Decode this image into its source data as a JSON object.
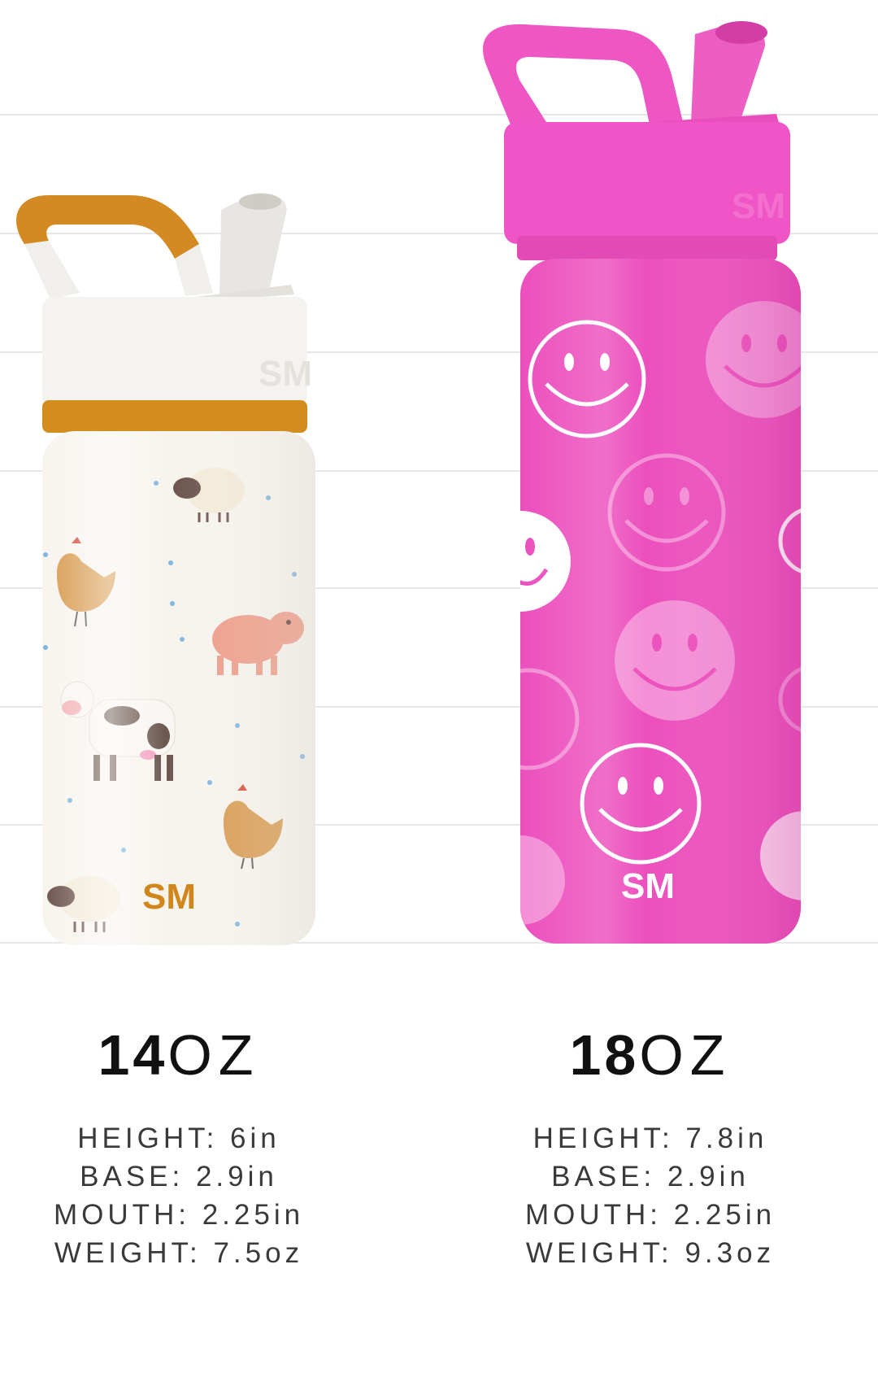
{
  "products": [
    {
      "size_number": "14",
      "size_unit": "OZ",
      "height": "HEIGHT: 6in",
      "base": "BASE: 2.9in",
      "mouth": "MOUTH: 2.25in",
      "weight": "WEIGHT: 7.5oz",
      "logo_text": "SM",
      "lid_logo_text": "SM",
      "colors": {
        "body": "#f7f4ee",
        "lid": "#f5f4f1",
        "accent": "#d58c1f",
        "logo": "#d1861c"
      }
    },
    {
      "size_number": "18",
      "size_unit": "OZ",
      "height": "HEIGHT: 7.8in",
      "base": "BASE: 2.9in",
      "mouth": "MOUTH: 2.25in",
      "weight": "WEIGHT: 9.3oz",
      "logo_text": "SM",
      "lid_logo_text": "SM",
      "colors": {
        "body": "#ec4fbd",
        "lid": "#ef55c6",
        "accent": "#f48fd6",
        "logo": "#ffffff"
      }
    }
  ]
}
